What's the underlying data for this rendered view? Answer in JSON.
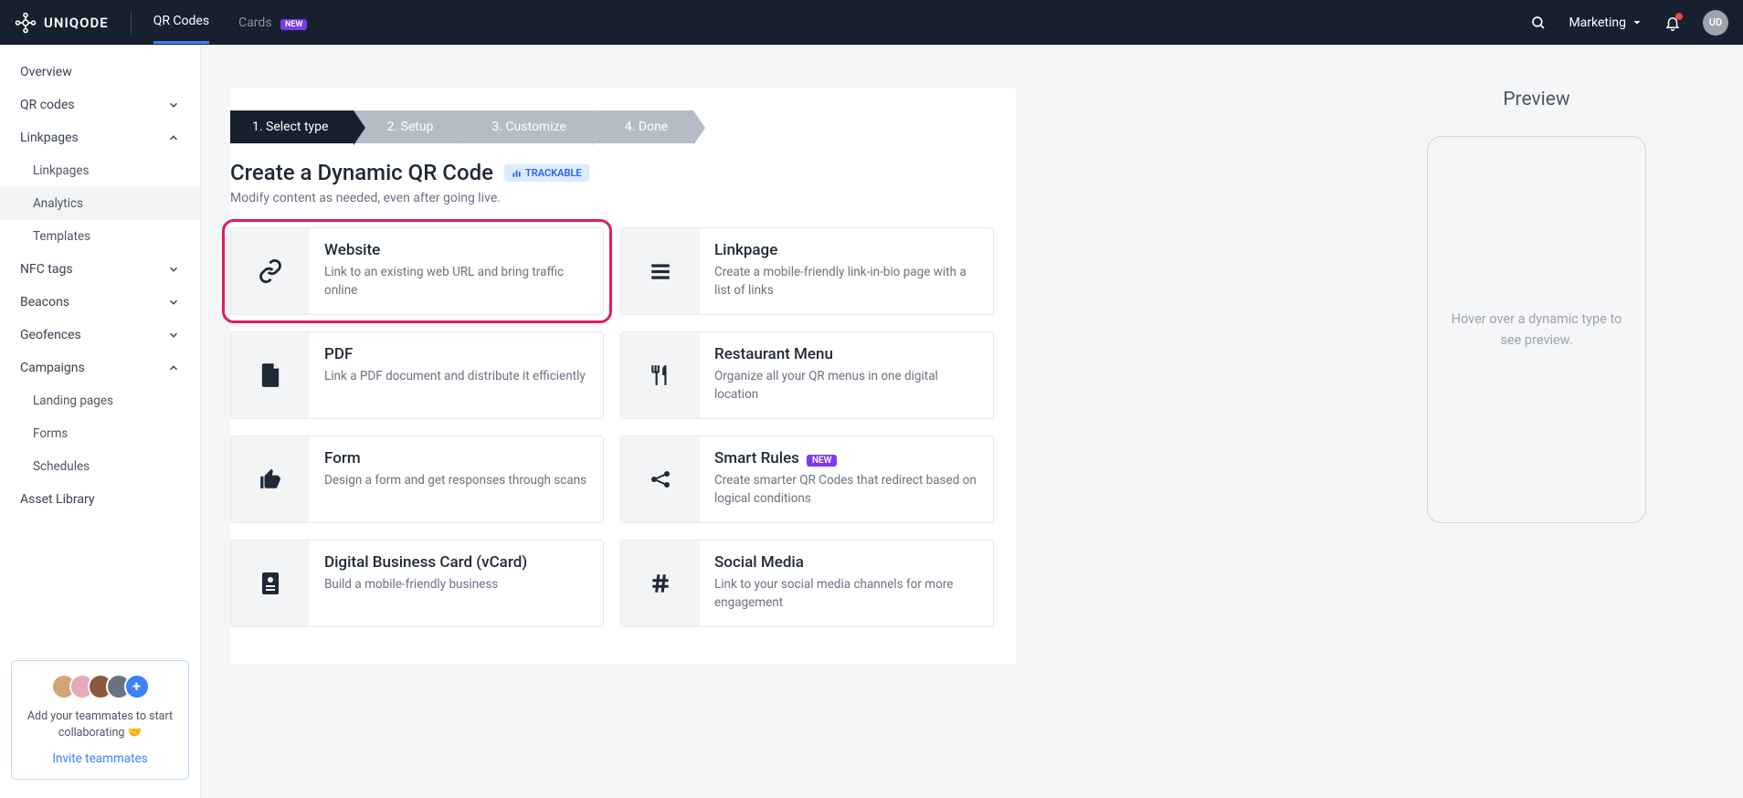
{
  "brand": "UNIQODE",
  "topnav": {
    "qr_codes": "QR Codes",
    "cards": "Cards",
    "cards_badge": "NEW"
  },
  "team": {
    "name": "Marketing"
  },
  "avatar_initials": "UD",
  "sidebar": {
    "overview": "Overview",
    "qr_codes": "QR codes",
    "linkpages": "Linkpages",
    "linkpages_sub": {
      "linkpages": "Linkpages",
      "analytics": "Analytics",
      "templates": "Templates"
    },
    "nfc_tags": "NFC tags",
    "beacons": "Beacons",
    "geofences": "Geofences",
    "campaigns": "Campaigns",
    "campaigns_sub": {
      "landing_pages": "Landing pages",
      "forms": "Forms",
      "schedules": "Schedules"
    },
    "asset_library": "Asset Library"
  },
  "invite": {
    "text": "Add your teammates to start collaborating 🤝",
    "link": "Invite teammates"
  },
  "stepper": {
    "s1": "1. Select type",
    "s2": "2. Setup",
    "s3": "3. Customize",
    "s4": "4. Done"
  },
  "page": {
    "title": "Create a Dynamic QR Code",
    "trackable": "TRACKABLE",
    "subtitle": "Modify content as needed, even after going live."
  },
  "types": {
    "website": {
      "title": "Website",
      "desc": "Link to an existing web URL and bring traffic online"
    },
    "linkpage": {
      "title": "Linkpage",
      "desc": "Create a mobile-friendly link-in-bio page with a list of links"
    },
    "pdf": {
      "title": "PDF",
      "desc": "Link a PDF document and distribute it efficiently"
    },
    "restaurant": {
      "title": "Restaurant Menu",
      "desc": "Organize all your QR menus in one digital location"
    },
    "form": {
      "title": "Form",
      "desc": "Design a form and get responses through scans"
    },
    "smart_rules": {
      "title": "Smart Rules",
      "badge": "NEW",
      "desc": "Create smarter QR Codes that redirect based on logical conditions"
    },
    "vcard": {
      "title": "Digital Business Card (vCard)",
      "desc": "Build a mobile-friendly business"
    },
    "social": {
      "title": "Social Media",
      "desc": "Link to your social media channels for more engagement"
    }
  },
  "preview": {
    "title": "Preview",
    "placeholder": "Hover over a dynamic type to see preview."
  }
}
